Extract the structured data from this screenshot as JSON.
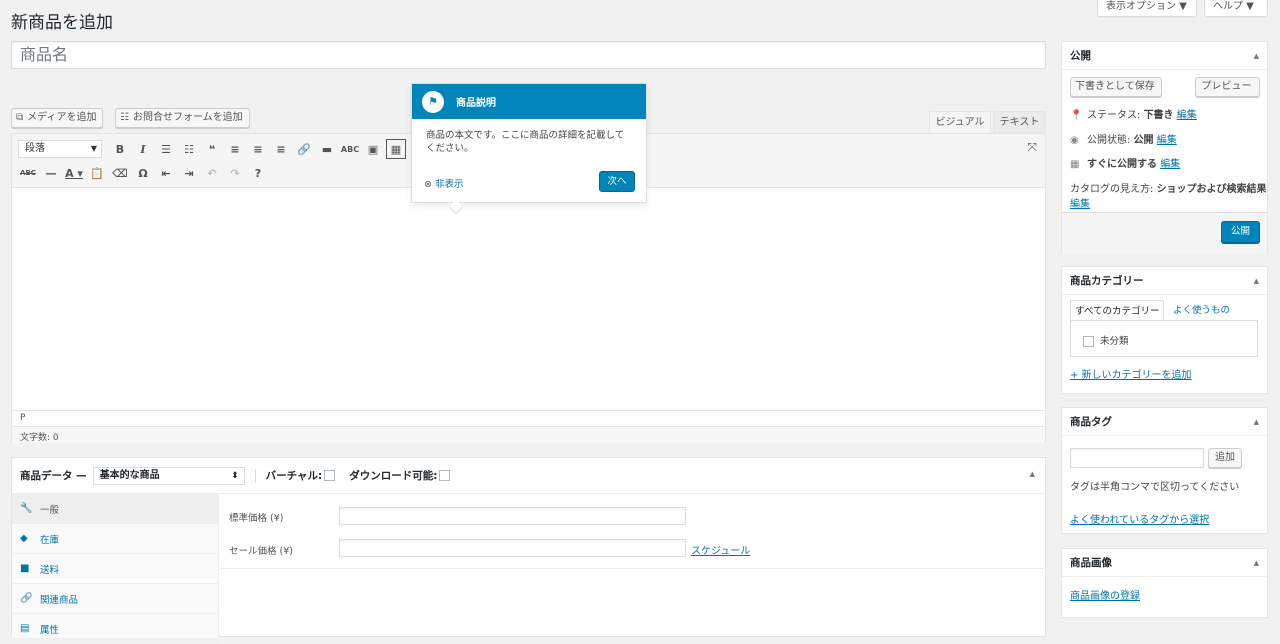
{
  "screen_options": {
    "display_label": "表示オプション ▼",
    "help_label": "ヘルプ ▼"
  },
  "page": {
    "title": "新商品を追加",
    "title_placeholder": "商品名"
  },
  "media": {
    "add_media": "メディアを追加",
    "add_form": "お問合せフォームを追加"
  },
  "editor": {
    "tab_visual": "ビジュアル",
    "tab_text": "テキスト",
    "format": "段落",
    "path": "P",
    "word_count": "文字数: 0"
  },
  "pointer": {
    "title": "商品説明",
    "body": "商品の本文です。ここに商品の詳細を記載してください。",
    "dismiss": "非表示",
    "next": "次へ"
  },
  "product_data": {
    "label": "商品データ —",
    "type": "基本的な商品",
    "virtual": "バーチャル:",
    "downloadable": "ダウンロード可能:",
    "tabs": [
      {
        "label": "一般",
        "icon": "wrench-icon"
      },
      {
        "label": "在庫",
        "icon": "tag-icon"
      },
      {
        "label": "送料",
        "icon": "truck-icon"
      },
      {
        "label": "関連商品",
        "icon": "link-icon"
      },
      {
        "label": "属性",
        "icon": "list-icon"
      }
    ],
    "regular_price": "標準価格 (¥)",
    "sale_price": "セール価格 (¥)",
    "schedule": "スケジュール"
  },
  "publish": {
    "title": "公開",
    "save_draft": "下書きとして保存",
    "preview": "プレビュー",
    "status_label": "ステータス:",
    "status_value": "下書き",
    "visibility_label": "公開状態:",
    "visibility_value": "公開",
    "publish_time": "すぐに公開する",
    "catalog_label": "カタログの見え方:",
    "catalog_value": "ショップおよび検索結果",
    "edit": "編集",
    "publish_btn": "公開"
  },
  "categories": {
    "title": "商品カテゴリー",
    "tab_all": "すべてのカテゴリー",
    "tab_popular": "よく使うもの",
    "items": [
      "未分類"
    ],
    "add_new": "+ 新しいカテゴリーを追加"
  },
  "tags": {
    "title": "商品タグ",
    "add_btn": "追加",
    "hint": "タグは半角コンマで区切ってください",
    "choose": "よく使われているタグから選択"
  },
  "product_image": {
    "title": "商品画像",
    "set_link": "商品画像の登録"
  }
}
